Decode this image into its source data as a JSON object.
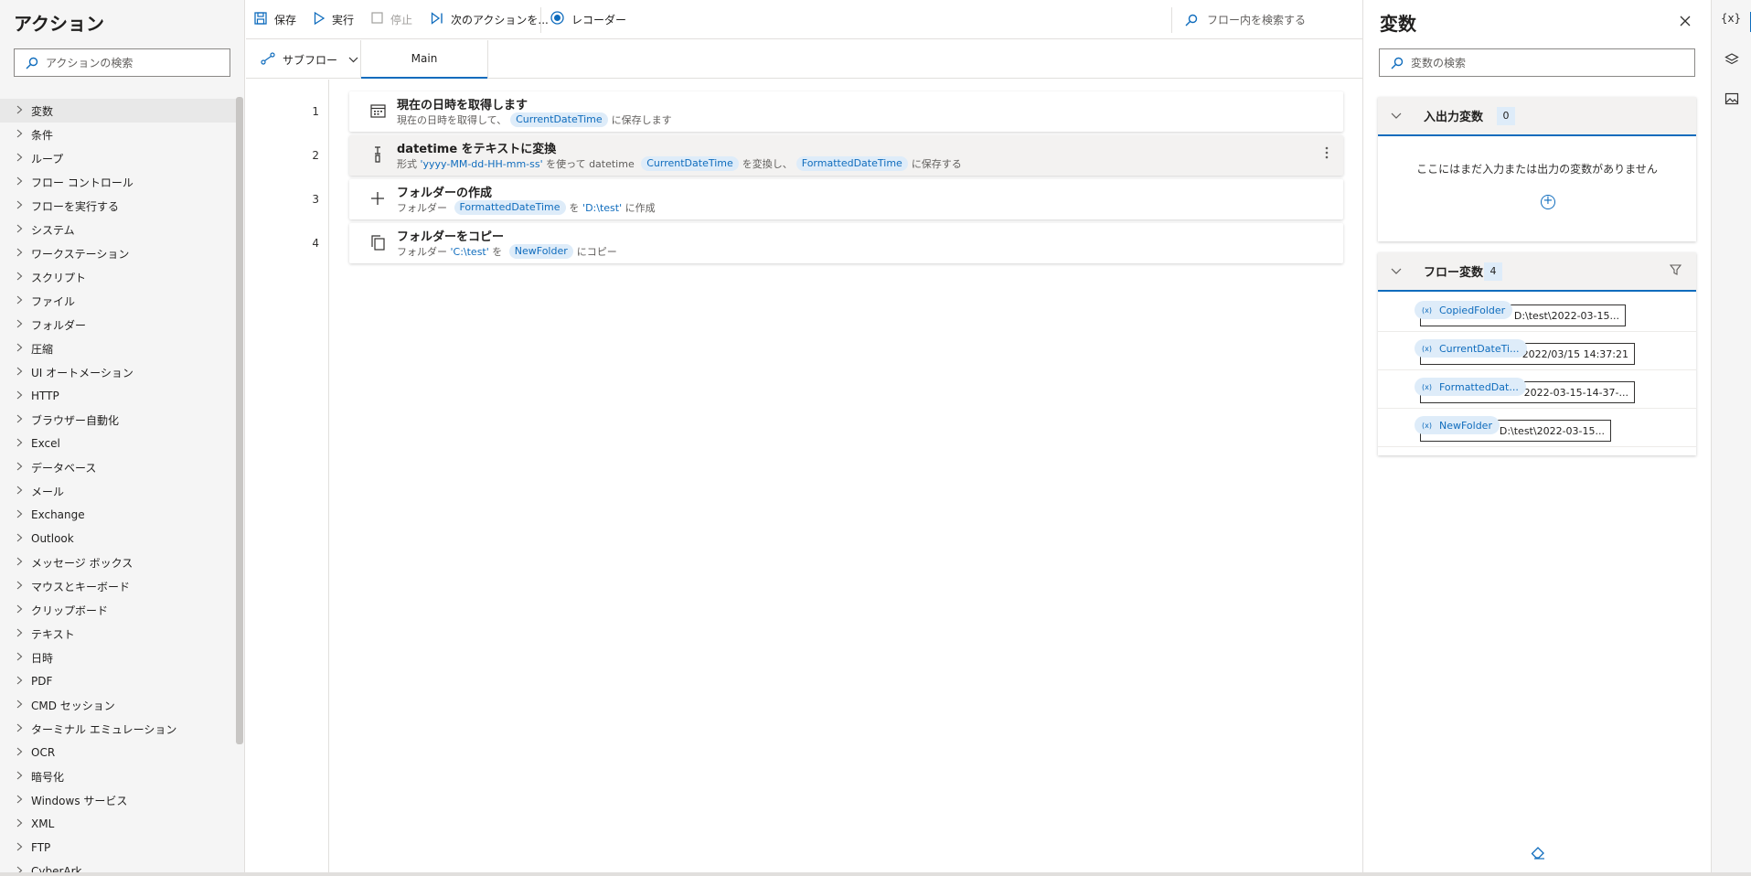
{
  "actions": {
    "title": "アクション",
    "search_placeholder": "アクションの検索",
    "items": [
      "変数",
      "条件",
      "ループ",
      "フロー コントロール",
      "フローを実行する",
      "システム",
      "ワークステーション",
      "スクリプト",
      "ファイル",
      "フォルダー",
      "圧縮",
      "UI オートメーション",
      "HTTP",
      "ブラウザー自動化",
      "Excel",
      "データベース",
      "メール",
      "Exchange",
      "Outlook",
      "メッセージ ボックス",
      "マウスとキーボード",
      "クリップボード",
      "テキスト",
      "日時",
      "PDF",
      "CMD セッション",
      "ターミナル エミュレーション",
      "OCR",
      "暗号化",
      "Windows サービス",
      "XML",
      "FTP",
      "CyberArk"
    ]
  },
  "toolbar": {
    "save": "保存",
    "run": "実行",
    "stop": "停止",
    "next_action": "次のアクションを...",
    "recorder": "レコーダー",
    "flow_search": "フロー内を検索する"
  },
  "tabs": {
    "subflow": "サブフロー",
    "main": "Main"
  },
  "steps": [
    {
      "num": "1",
      "title": "現在の日時を取得します",
      "icon": "calendar-icon",
      "desc": [
        {
          "t": "text",
          "v": "現在の日時を取得して、"
        },
        {
          "t": "chip",
          "v": "CurrentDateTime"
        },
        {
          "t": "text",
          "v": "に保存します"
        }
      ]
    },
    {
      "num": "2",
      "title": "datetime をテキストに変換",
      "icon": "convert-icon",
      "desc": [
        {
          "t": "text",
          "v": "形式 "
        },
        {
          "t": "lit",
          "v": "'yyyy-MM-dd-HH-mm-ss'"
        },
        {
          "t": "text",
          "v": " を使って datetime "
        },
        {
          "t": "chip",
          "v": "CurrentDateTime"
        },
        {
          "t": "text",
          "v": "を変換し、"
        },
        {
          "t": "chip",
          "v": "FormattedDateTime"
        },
        {
          "t": "text",
          "v": "に保存する"
        }
      ]
    },
    {
      "num": "3",
      "title": "フォルダーの作成",
      "icon": "plus-icon",
      "desc": [
        {
          "t": "text",
          "v": "フォルダー "
        },
        {
          "t": "chip",
          "v": "FormattedDateTime"
        },
        {
          "t": "text",
          "v": "を "
        },
        {
          "t": "lit",
          "v": "'D:\\test'"
        },
        {
          "t": "text",
          "v": " に作成"
        }
      ]
    },
    {
      "num": "4",
      "title": "フォルダーをコピー",
      "icon": "copy-icon",
      "desc": [
        {
          "t": "text",
          "v": "フォルダー "
        },
        {
          "t": "lit",
          "v": "'C:\\test'"
        },
        {
          "t": "text",
          "v": " を "
        },
        {
          "t": "chip",
          "v": "NewFolder"
        },
        {
          "t": "text",
          "v": "にコピー"
        }
      ]
    }
  ],
  "variables": {
    "title": "変数",
    "search_placeholder": "変数の検索",
    "io": {
      "title": "入出力変数",
      "count": "0",
      "empty": "ここにはまだ入力または出力の変数がありません"
    },
    "flow": {
      "title": "フロー変数",
      "count": "4",
      "items": [
        {
          "name": "CopiedFolder",
          "value": "D:\\test\\2022-03-15..."
        },
        {
          "name": "CurrentDateTi...",
          "value": "2022/03/15 14:37:21"
        },
        {
          "name": "FormattedDat...",
          "value": "2022-03-15-14-37-..."
        },
        {
          "name": "NewFolder",
          "value": "D:\\test\\2022-03-15..."
        }
      ]
    }
  },
  "rail": {
    "variables_icon": "{x}"
  },
  "colors": {
    "accent": "#0f6cbd",
    "chip_bg": "#deecf9"
  }
}
